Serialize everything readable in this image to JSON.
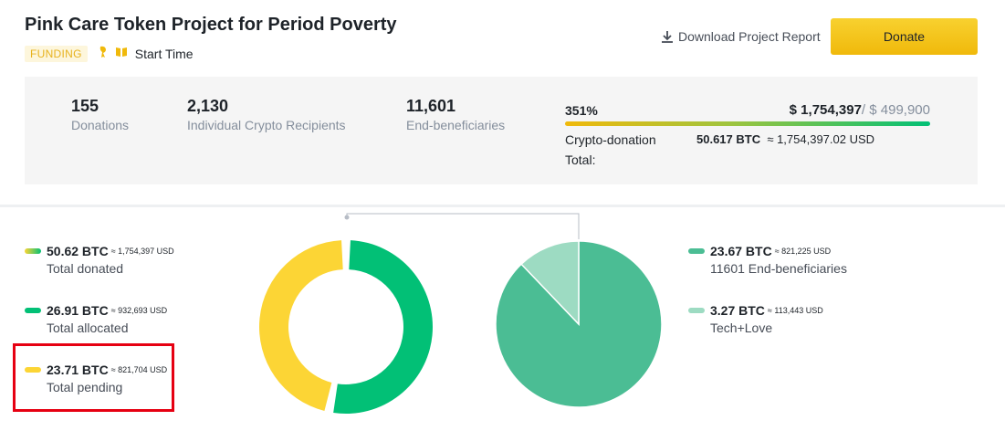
{
  "header": {
    "title": "Pink Care Token Project for Period Poverty",
    "badge": "FUNDING",
    "start_time_label": "Start Time",
    "download_label": "Download Project Report",
    "donate_label": "Donate"
  },
  "stats": [
    {
      "value": "155",
      "label": "Donations"
    },
    {
      "value": "2,130",
      "label": "Individual Crypto Recipients"
    },
    {
      "value": "11,601",
      "label": "End-beneficiaries"
    }
  ],
  "funding": {
    "percent": "351%",
    "raised": "$ 1,754,397",
    "goal": "/ $ 499,900",
    "crypto_label": "Crypto-donation",
    "total_label": "Total:",
    "btc_value": "50.617 BTC",
    "usd_value": "≈ 1,754,397.02 USD"
  },
  "colors": {
    "yellow": "#fcd535",
    "green": "#02c076",
    "pie_main": "#4bbd94",
    "pie_light": "#9ddbc2",
    "highlight": "#e60012"
  },
  "legend_left": [
    {
      "btc": "50.62 BTC",
      "usd": "≈ 1,754,397 USD",
      "label": "Total donated"
    },
    {
      "btc": "26.91 BTC",
      "usd": "≈ 932,693 USD",
      "label": "Total allocated"
    },
    {
      "btc": "23.71 BTC",
      "usd": "≈ 821,704 USD",
      "label": "Total pending"
    }
  ],
  "legend_right": [
    {
      "btc": "23.67 BTC",
      "usd": "≈ 821,225 USD",
      "label": "11601 End-beneficiaries"
    },
    {
      "btc": "3.27 BTC",
      "usd": "≈ 113,443 USD",
      "label": "Tech+Love"
    }
  ],
  "chart_data": [
    {
      "type": "pie",
      "categories": [
        "Total allocated",
        "Total pending"
      ],
      "values": [
        26.91,
        23.71
      ]
    },
    {
      "type": "pie",
      "categories": [
        "11601 End-beneficiaries",
        "Tech+Love"
      ],
      "values": [
        23.67,
        3.27
      ]
    }
  ]
}
